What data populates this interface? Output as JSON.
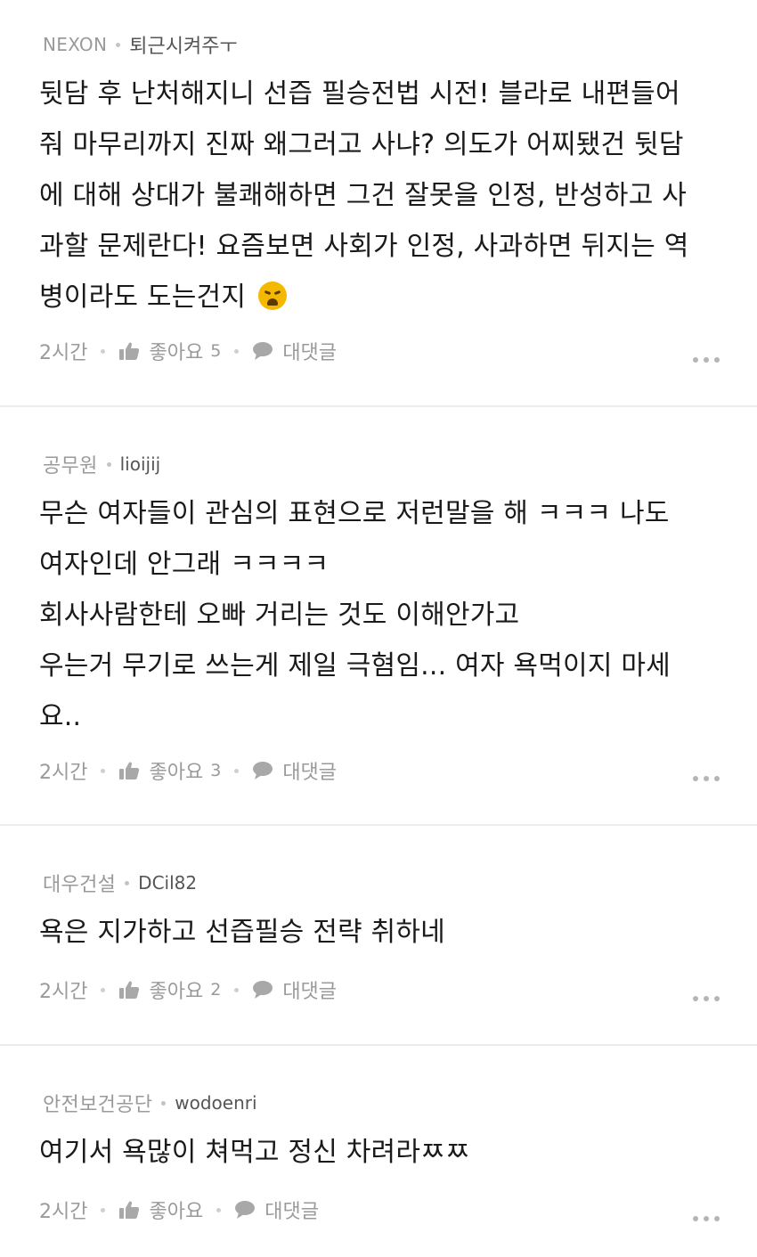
{
  "comments": [
    {
      "company": "NEXON",
      "nickname": "퇴근시켜주ㅜ",
      "text": "뒷담 후 난처해지니 선즙 필승전법 시전! 블라로 내편들어\n줘 마무리까지 진짜 왜그러고 사냐? 의도가 어찌됐건 뒷담\n에 대해 상대가 불쾌해하면 그건 잘못을 인정, 반성하고 사\n과할 문제란다! 요즘보면 사회가 인정, 사과하면 뒤지는 역\n병이라도 도는건지",
      "emoji": "weary-face-icon",
      "time": "2시간",
      "like_label": "좋아요",
      "like_count": "5",
      "reply_label": "대댓글"
    },
    {
      "company": "공무원",
      "nickname": "lioijij",
      "text": "무슨 여자들이 관심의 표현으로 저런말을 해 ㅋㅋㅋ 나도\n여자인데 안그래 ㅋㅋㅋㅋ\n회사사람한테 오빠 거리는 것도 이해안가고\n우는거 무기로 쓰는게 제일 극혐임... 여자 욕먹이지 마세\n요..",
      "time": "2시간",
      "like_label": "좋아요",
      "like_count": "3",
      "reply_label": "대댓글"
    },
    {
      "company": "대우건설",
      "nickname": "DCil82",
      "text": "욕은 지가하고 선즙필승 전략 취하네",
      "time": "2시간",
      "like_label": "좋아요",
      "like_count": "2",
      "reply_label": "대댓글"
    },
    {
      "company": "안전보건공단",
      "nickname": "wodoenri",
      "text": "여기서 욕많이 쳐먹고 정신 차려라ㅉㅉ",
      "time": "2시간",
      "like_label": "좋아요",
      "like_count": "",
      "reply_label": "대댓글"
    }
  ],
  "colors": {
    "text": "#1a1a1a",
    "meta": "#9a9a9a",
    "divider": "#ececec"
  }
}
